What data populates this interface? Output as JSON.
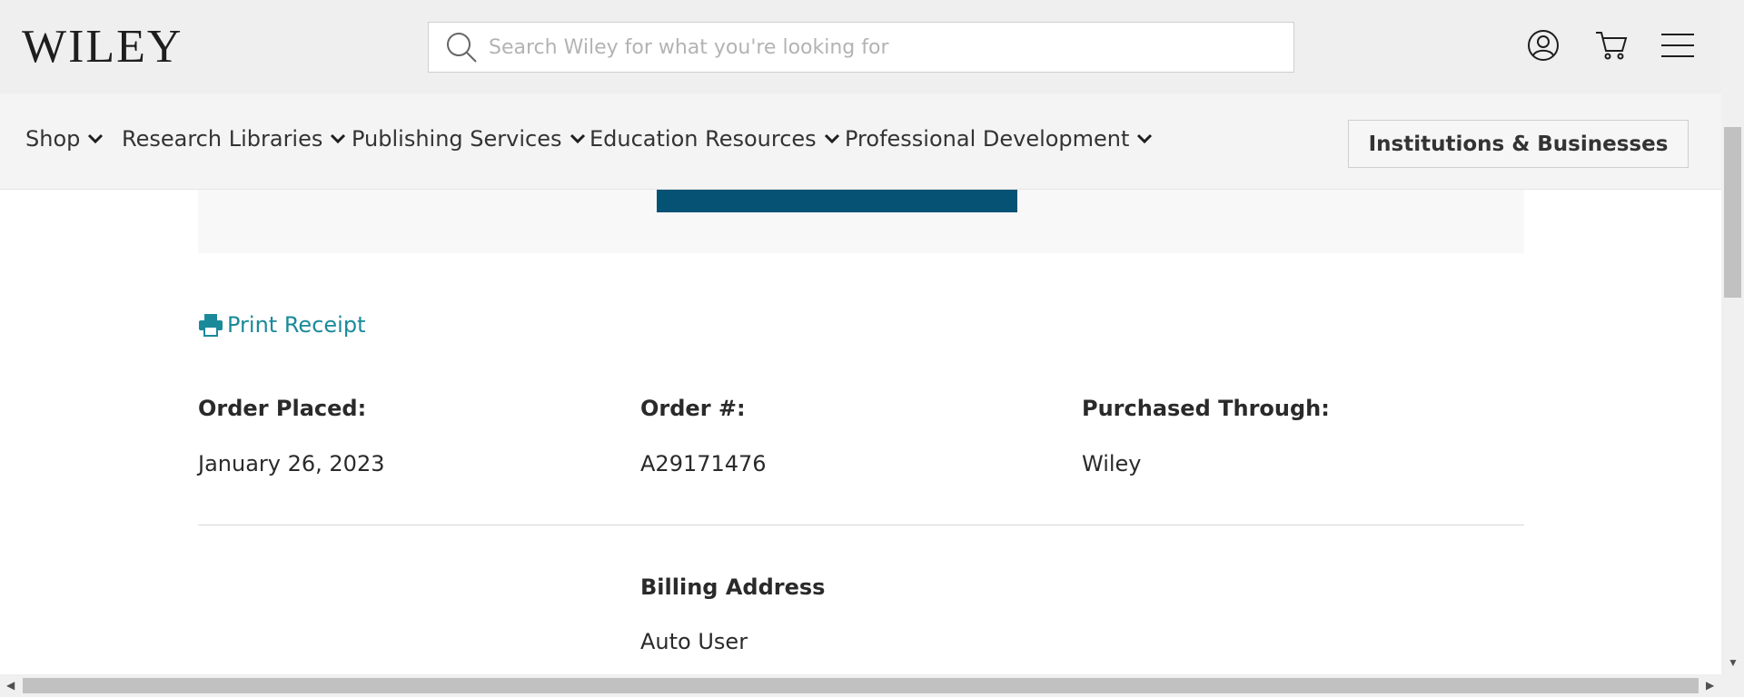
{
  "header": {
    "logo": "WILEY",
    "search": {
      "placeholder": "Search Wiley for what you're looking for",
      "value": ""
    },
    "icons": [
      "account-icon",
      "cart-icon",
      "menu-icon"
    ]
  },
  "nav": {
    "items": [
      {
        "label": "Shop"
      },
      {
        "label": "Research Libraries"
      },
      {
        "label": "Publishing Services"
      },
      {
        "label": "Education Resources"
      },
      {
        "label": "Professional Development"
      }
    ],
    "institutions_button": "Institutions & Businesses"
  },
  "order": {
    "print_receipt": "Print Receipt",
    "placed_label": "Order Placed:",
    "placed_value": "January 26, 2023",
    "number_label": "Order #:",
    "number_value": "A29171476",
    "purchased_label": "Purchased Through:",
    "purchased_value": "Wiley",
    "billing_label": "Billing Address",
    "billing_name": "Auto User"
  },
  "colors": {
    "accent_teal_link": "#1a8a9a",
    "primary_button": "#055274",
    "header_bg": "#efefef"
  }
}
